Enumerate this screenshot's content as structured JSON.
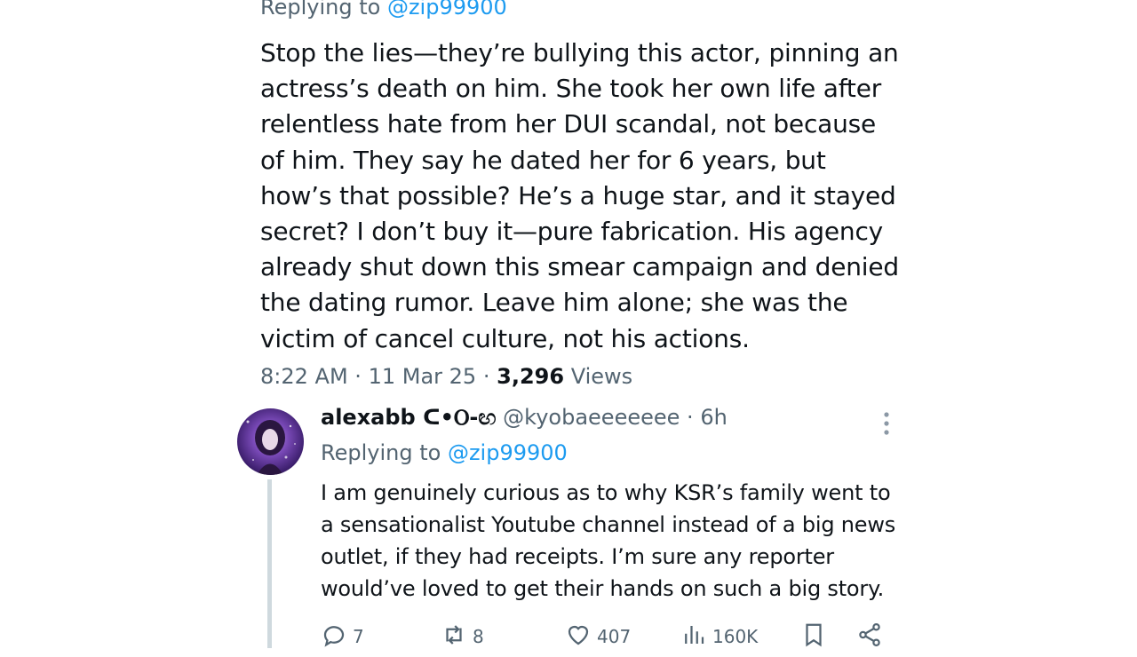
{
  "main_post": {
    "replying_prefix": "Replying to",
    "replying_handle": "@zip99900",
    "text": "Stop the lies—they’re bullying this actor, pinning an actress’s death on him. She took her own life after relentless hate from her DUI scandal, not because of him. They say he dated her for 6 years, but how’s that possible? He’s a huge star, and it stayed secret? I don’t buy it—pure fabrication. His agency already shut down this smear campaign and denied the dating rumor. Leave him alone; she was the victim of cancel culture, not his actions.",
    "time": "8:22 AM",
    "date": "11 Mar 25",
    "views_count": "3,296",
    "views_label": "Views"
  },
  "reply": {
    "display_name": "alexabb ᑕ•Ⲟ-ඟ",
    "handle": "@kyobaeeeeeee",
    "age": "6h",
    "replying_prefix": "Replying to",
    "replying_handle": "@zip99900",
    "text": "I am genuinely curious as to why KSR’s family went to a sensationalist Youtube channel instead of a big news outlet, if they had receipts. I’m sure any reporter would’ve loved to get their hands on such a big story.",
    "actions": {
      "replies": "7",
      "reposts": "8",
      "likes": "407",
      "views": "160K"
    }
  },
  "colors": {
    "link": "#1d9bf0",
    "secondary_text": "#536471",
    "primary_text": "#0f1419",
    "thread_line": "#cfd9de"
  },
  "icons": [
    "more-icon",
    "reply-icon",
    "repost-icon",
    "like-icon",
    "views-icon",
    "bookmark-icon",
    "share-icon"
  ]
}
